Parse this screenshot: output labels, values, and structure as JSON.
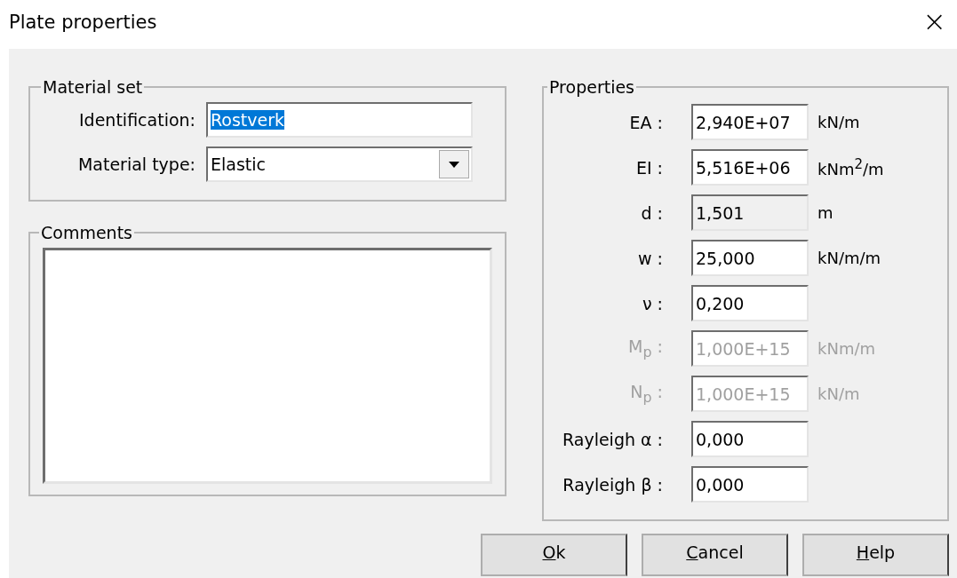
{
  "window": {
    "title": "Plate properties",
    "close": "×"
  },
  "material_set": {
    "title": "Material set",
    "identification": {
      "label": "Identification:",
      "value": "Rostverk",
      "selected": true
    },
    "material_type": {
      "label": "Material type:",
      "value": "Elastic"
    }
  },
  "comments": {
    "title": "Comments"
  },
  "properties": {
    "title": "Properties",
    "rows": [
      {
        "label": "EA :",
        "value": "2,940E+07",
        "unit": "kN/m",
        "kind": "editable"
      },
      {
        "label": "EI :",
        "value": "5,516E+06",
        "unit": "kNm$^{2}$/m",
        "kind": "editable"
      },
      {
        "label": "d :",
        "value": "1,501",
        "unit": "m",
        "kind": "readonly"
      },
      {
        "label": "w :",
        "value": "25,000",
        "unit": "kN/m/m",
        "kind": "editable"
      },
      {
        "label": "ν :",
        "value": "0,200",
        "kind": "editable"
      },
      {
        "label": "M$_{p}$ :",
        "value": "1,000E+15",
        "unit": "kNm/m",
        "kind": "disabled"
      },
      {
        "label": "N$_{p}$ :",
        "value": "1,000E+15",
        "unit": "kN/m",
        "kind": "disabled"
      },
      {
        "label": "Rayleigh α :",
        "value": "0,000",
        "kind": "editable"
      },
      {
        "label": "Rayleigh β :",
        "value": "0,000",
        "kind": "editable"
      }
    ]
  },
  "buttons": [
    "Ok",
    "Cancel",
    "Help"
  ]
}
